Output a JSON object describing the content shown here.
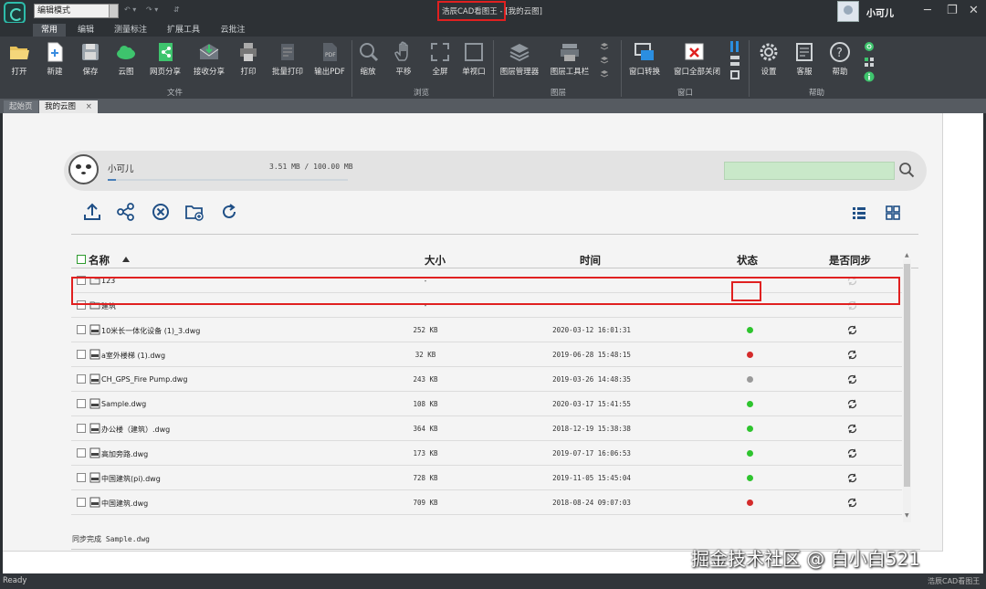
{
  "titlebar": {
    "mode_select": "编辑模式",
    "title": "浩辰CAD看图王 - [我的云图]",
    "user_name": "小可儿"
  },
  "ribbon": {
    "tabs": [
      "常用",
      "编辑",
      "测量标注",
      "扩展工具",
      "云批注"
    ],
    "buttons": {
      "open": "打开",
      "new": "新建",
      "save": "保存",
      "cloud": "云图",
      "web_share": "网页分享",
      "receive_share": "接收分享",
      "print": "打印",
      "batch_print": "批量打印",
      "export_pdf": "输出PDF",
      "zoom": "缩放",
      "pan": "平移",
      "fullscreen": "全屏",
      "single_viewport": "单视口",
      "layer_manager": "图层管理器",
      "layer_toolbar": "图层工具栏",
      "window_switch": "窗口转换",
      "close_all": "窗口全部关闭",
      "settings": "设置",
      "support": "客服",
      "help": "帮助"
    },
    "groups": {
      "file": "文件",
      "view": "浏览",
      "layer": "图层",
      "window": "窗口",
      "help": "帮助"
    }
  },
  "doc_tabs": [
    "起始页",
    "我的云图"
  ],
  "cloud": {
    "user_name": "小可儿",
    "quota": "3.51 MB / 100.00 MB",
    "quota_fraction": 0.0351,
    "search_placeholder": ""
  },
  "table": {
    "headers": {
      "name": "名称",
      "size": "大小",
      "time": "时间",
      "status": "状态",
      "sync": "是否同步"
    },
    "rows": [
      {
        "type": "folder",
        "name": "123",
        "size": "-",
        "time": "",
        "status": "",
        "sync": "disabled"
      },
      {
        "type": "folder",
        "name": "建筑",
        "size": "-",
        "time": "",
        "status": "",
        "sync": "disabled"
      },
      {
        "type": "dwg",
        "name": "10米长一体化设备 (1)_3.dwg",
        "size": "252 KB",
        "time": "2020-03-12 16:01:31",
        "status": "green",
        "sync": "enabled"
      },
      {
        "type": "dwg",
        "name": "a室外楼梯 (1).dwg",
        "size": "32 KB",
        "time": "2019-06-28 15:48:15",
        "status": "red",
        "sync": "enabled"
      },
      {
        "type": "dwg",
        "name": "CH_GPS_Fire Pump.dwg",
        "size": "243 KB",
        "time": "2019-03-26 14:48:35",
        "status": "gray",
        "sync": "enabled"
      },
      {
        "type": "dwg",
        "name": "Sample.dwg",
        "size": "108 KB",
        "time": "2020-03-17 15:41:55",
        "status": "green",
        "sync": "enabled"
      },
      {
        "type": "dwg",
        "name": "办公楼（建筑）.dwg",
        "size": "364 KB",
        "time": "2018-12-19 15:38:38",
        "status": "green",
        "sync": "enabled"
      },
      {
        "type": "dwg",
        "name": "高加旁路.dwg",
        "size": "173 KB",
        "time": "2019-07-17 16:06:53",
        "status": "green",
        "sync": "enabled"
      },
      {
        "type": "dwg",
        "name": "中国建筑(pi).dwg",
        "size": "728 KB",
        "time": "2019-11-05 15:45:04",
        "status": "green",
        "sync": "enabled"
      },
      {
        "type": "dwg",
        "name": "中国建筑.dwg",
        "size": "709 KB",
        "time": "2018-08-24 09:07:03",
        "status": "red",
        "sync": "enabled"
      }
    ]
  },
  "sync_message": "同步完成 Sample.dwg",
  "statusbar": {
    "ready": "Ready",
    "app_name": "浩辰CAD看图王"
  },
  "watermark": "掘金技术社区 @ 白小白521",
  "colors": {
    "status_green": "#2ec42e",
    "status_red": "#d42b2b",
    "status_gray": "#9a9a9a",
    "highlight_red": "#e02020",
    "search_bg": "#c9e8c9"
  }
}
